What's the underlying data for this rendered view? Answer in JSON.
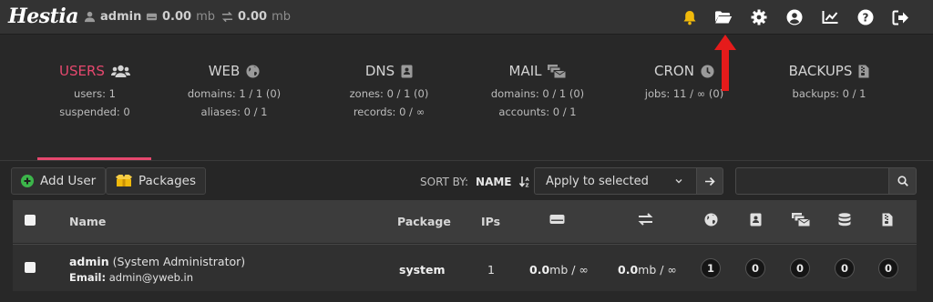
{
  "topbar": {
    "logo": "Hestia",
    "user": "admin",
    "disk_value": "0.00",
    "disk_unit": "mb",
    "bandwidth_value": "0.00",
    "bandwidth_unit": "mb",
    "icons": [
      "bell-icon",
      "folder-open-icon",
      "gear-icon",
      "user-circle-icon",
      "chart-line-icon",
      "question-icon",
      "sign-out-icon"
    ]
  },
  "tabs": [
    {
      "title": "USERS",
      "icon": "users-icon",
      "line1": "users: 1",
      "line2": "suspended: 0",
      "active": true
    },
    {
      "title": "WEB",
      "icon": "globe-icon",
      "line1": "domains: 1 / 1 (0)",
      "line2": "aliases: 0 / 1",
      "active": false
    },
    {
      "title": "DNS",
      "icon": "book-icon",
      "line1": "zones: 0 / 1 (0)",
      "line2": "records: 0 / ∞",
      "active": false
    },
    {
      "title": "MAIL",
      "icon": "mail-bulk-icon",
      "line1": "domains: 0 / 1 (0)",
      "line2": "accounts: 0 / 1",
      "active": false
    },
    {
      "title": "CRON",
      "icon": "clock-icon",
      "line1": "jobs: 11 / ∞ (0)",
      "line2": "",
      "active": false
    },
    {
      "title": "BACKUPS",
      "icon": "file-archive-icon",
      "line1": "backups: 0 / 1",
      "line2": "",
      "active": false
    }
  ],
  "toolbar": {
    "add_user": "Add User",
    "packages": "Packages",
    "sort_label": "SORT BY:",
    "sort_value": "NAME",
    "apply_select": "Apply to selected",
    "search_placeholder": ""
  },
  "table": {
    "headers": {
      "name": "Name",
      "package": "Package",
      "ips": "IPs"
    },
    "row": {
      "username": "admin",
      "fullname": "(System Administrator)",
      "email_label": "Email:",
      "email": "admin@yweb.in",
      "package": "system",
      "ips": "1",
      "disk_value": "0.0",
      "disk_rest": "mb / ∞",
      "bw_value": "0.0",
      "bw_rest": "mb / ∞",
      "counts": [
        "1",
        "0",
        "0",
        "0",
        "0"
      ]
    }
  },
  "colors": {
    "accent": "#e5486e",
    "bell": "#f0b90b",
    "annotation_arrow": "#e51b1b"
  }
}
